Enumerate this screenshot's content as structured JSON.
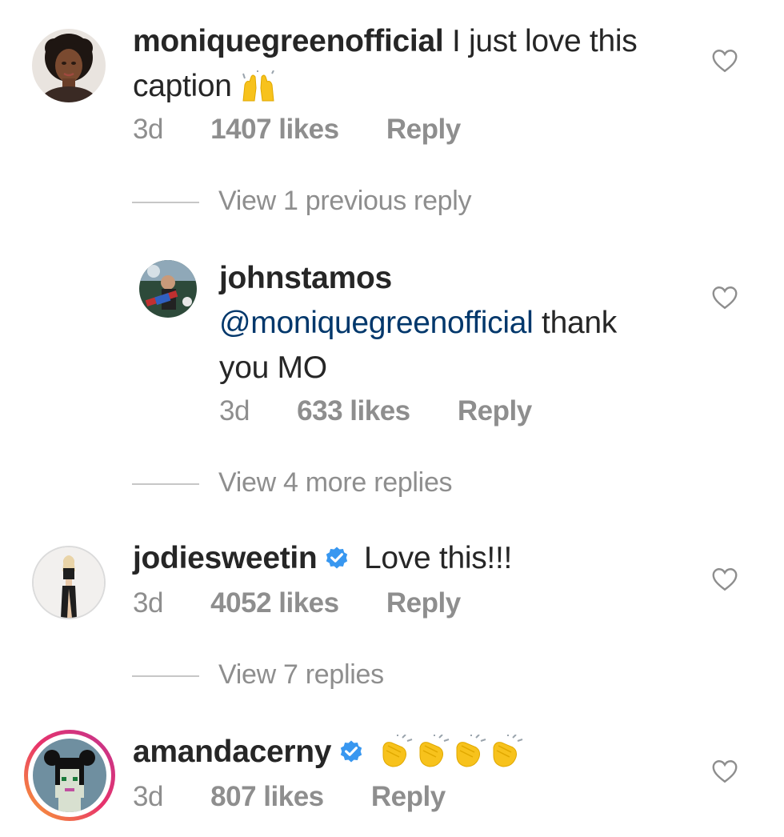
{
  "comments": [
    {
      "username": "moniquegreenofficial",
      "text_line1": "I just love this",
      "text_line2": "caption",
      "time": "3d",
      "likes": "1407 likes",
      "reply": "Reply",
      "verified": false
    },
    {
      "username": "johnstamos",
      "mention": "@moniquegreenofficial",
      "text_line1": "thank",
      "text_line2": "you MO",
      "time": "3d",
      "likes": "633 likes",
      "reply": "Reply",
      "verified": false
    },
    {
      "username": "jodiesweetin",
      "text_line1": "Love this!!!",
      "time": "3d",
      "likes": "4052 likes",
      "reply": "Reply",
      "verified": true
    },
    {
      "username": "amandacerny",
      "time": "3d",
      "likes": "807 likes",
      "reply": "Reply",
      "verified": true
    }
  ],
  "view_replies": [
    "View 1 previous reply",
    "View 4 more replies",
    "View 7 replies"
  ],
  "icons": {
    "raising_hands": "raising-hands-emoji-icon",
    "clapping_hands": "clapping-hands-emoji-icon",
    "heart": "heart-icon",
    "verified": "verified-badge-icon"
  },
  "colors": {
    "mention": "#00376b",
    "verified": "#3897f0",
    "secondary_text": "#8e8e8e",
    "emoji_yellow": "#f7c21c"
  }
}
